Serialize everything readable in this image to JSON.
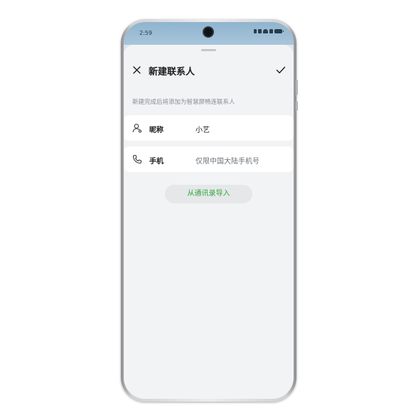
{
  "status_bar": {
    "time": "2:59"
  },
  "header": {
    "title": "新建联系人"
  },
  "hint_text": "新建完成后将添加为智慧屏畅连联系人",
  "form": {
    "nickname": {
      "label": "昵称",
      "value": "小艺"
    },
    "phone": {
      "label": "手机",
      "placeholder": "仅限中国大陆手机号"
    }
  },
  "import_button": {
    "label": "从通讯录导入"
  },
  "colors": {
    "accent_green": "#2fa83a",
    "status_bar_blue": "#a8c5db",
    "sheet_bg": "#f2f3f5"
  },
  "icons": {
    "close": "close-icon",
    "confirm": "check-icon",
    "nickname": "person-icon",
    "phone": "phone-icon"
  }
}
